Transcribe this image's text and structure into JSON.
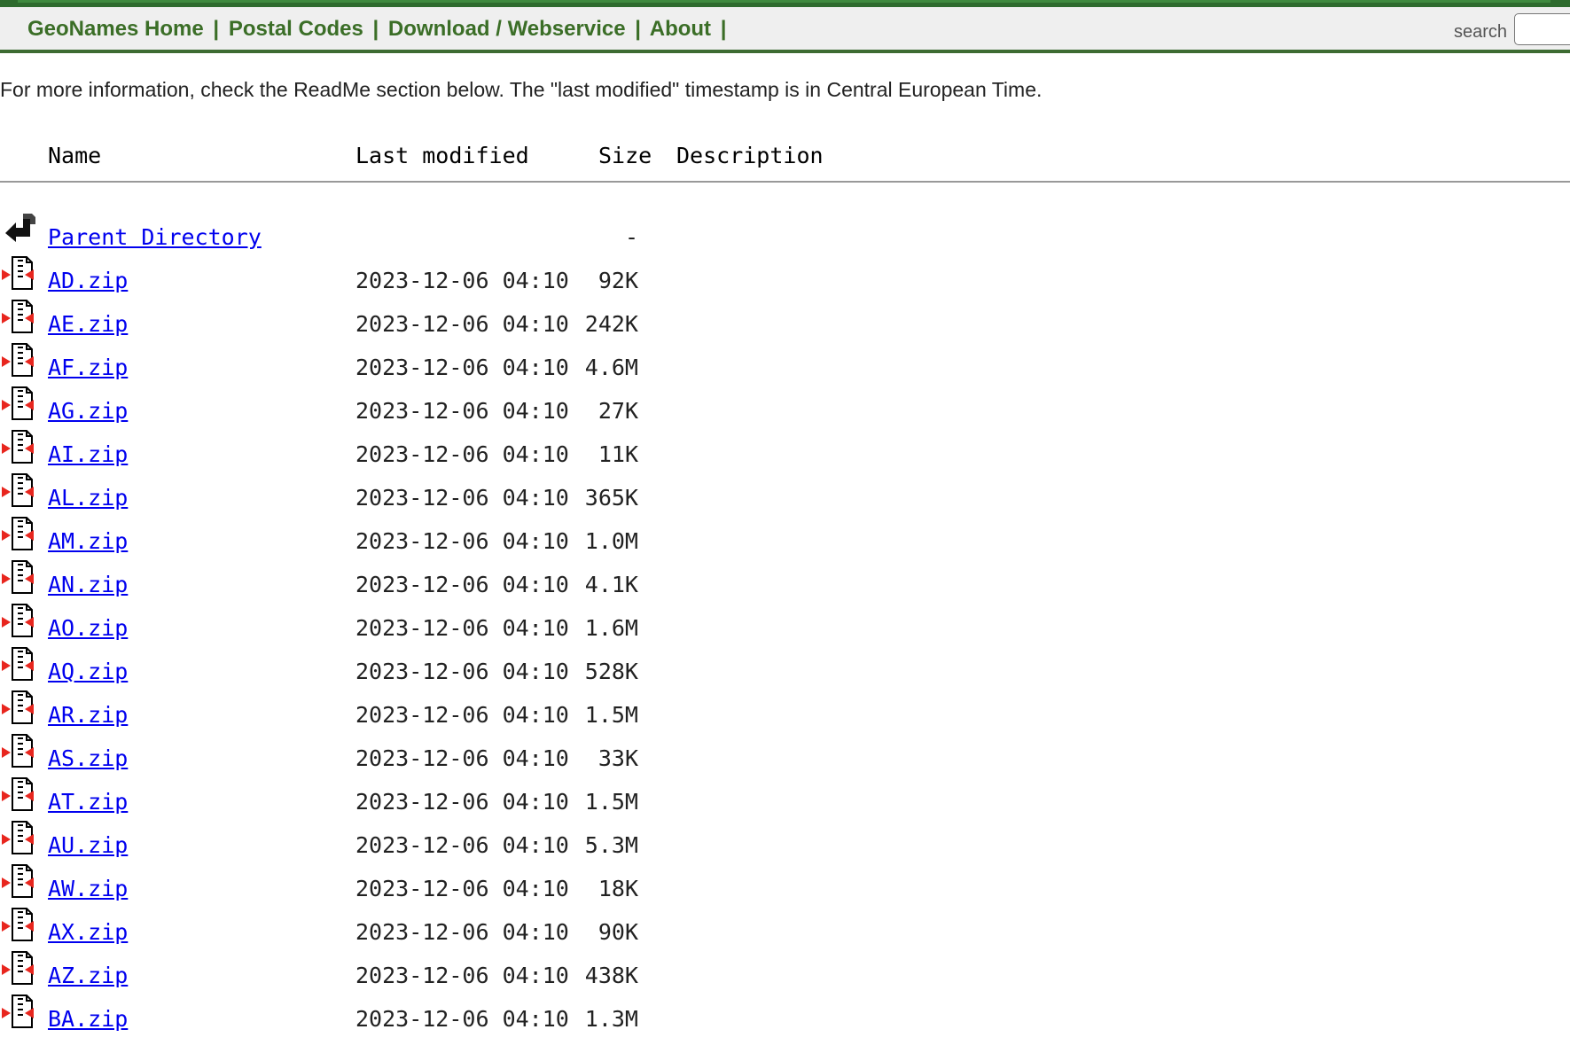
{
  "navbar": {
    "links": [
      "GeoNames Home",
      "Postal Codes",
      "Download / Webservice",
      "About"
    ],
    "separator": "|",
    "search_label": "search"
  },
  "info_text": "For more information, check the ReadMe section below. The \"last modified\" timestamp is in Central European Time.",
  "table": {
    "headers": {
      "name": "Name",
      "last_modified": "Last modified",
      "size": "Size",
      "description": "Description"
    },
    "parent": {
      "name": "Parent Directory",
      "size": "-"
    },
    "rows": [
      {
        "name": "AD.zip",
        "modified": "2023-12-06 04:10",
        "size": "92K"
      },
      {
        "name": "AE.zip",
        "modified": "2023-12-06 04:10",
        "size": "242K"
      },
      {
        "name": "AF.zip",
        "modified": "2023-12-06 04:10",
        "size": "4.6M"
      },
      {
        "name": "AG.zip",
        "modified": "2023-12-06 04:10",
        "size": "27K"
      },
      {
        "name": "AI.zip",
        "modified": "2023-12-06 04:10",
        "size": "11K"
      },
      {
        "name": "AL.zip",
        "modified": "2023-12-06 04:10",
        "size": "365K"
      },
      {
        "name": "AM.zip",
        "modified": "2023-12-06 04:10",
        "size": "1.0M"
      },
      {
        "name": "AN.zip",
        "modified": "2023-12-06 04:10",
        "size": "4.1K"
      },
      {
        "name": "AO.zip",
        "modified": "2023-12-06 04:10",
        "size": "1.6M"
      },
      {
        "name": "AQ.zip",
        "modified": "2023-12-06 04:10",
        "size": "528K"
      },
      {
        "name": "AR.zip",
        "modified": "2023-12-06 04:10",
        "size": "1.5M"
      },
      {
        "name": "AS.zip",
        "modified": "2023-12-06 04:10",
        "size": "33K"
      },
      {
        "name": "AT.zip",
        "modified": "2023-12-06 04:10",
        "size": "1.5M"
      },
      {
        "name": "AU.zip",
        "modified": "2023-12-06 04:10",
        "size": "5.3M"
      },
      {
        "name": "AW.zip",
        "modified": "2023-12-06 04:10",
        "size": "18K"
      },
      {
        "name": "AX.zip",
        "modified": "2023-12-06 04:10",
        "size": "90K"
      },
      {
        "name": "AZ.zip",
        "modified": "2023-12-06 04:10",
        "size": "438K"
      },
      {
        "name": "BA.zip",
        "modified": "2023-12-06 04:10",
        "size": "1.3M"
      }
    ]
  },
  "icons": {
    "parent": "back-arrow-icon",
    "file": "compressed-file-icon"
  },
  "colors": {
    "nav_green": "#3b6e27",
    "nav_border": "#3d6b32",
    "link_blue": "#0000ee"
  }
}
